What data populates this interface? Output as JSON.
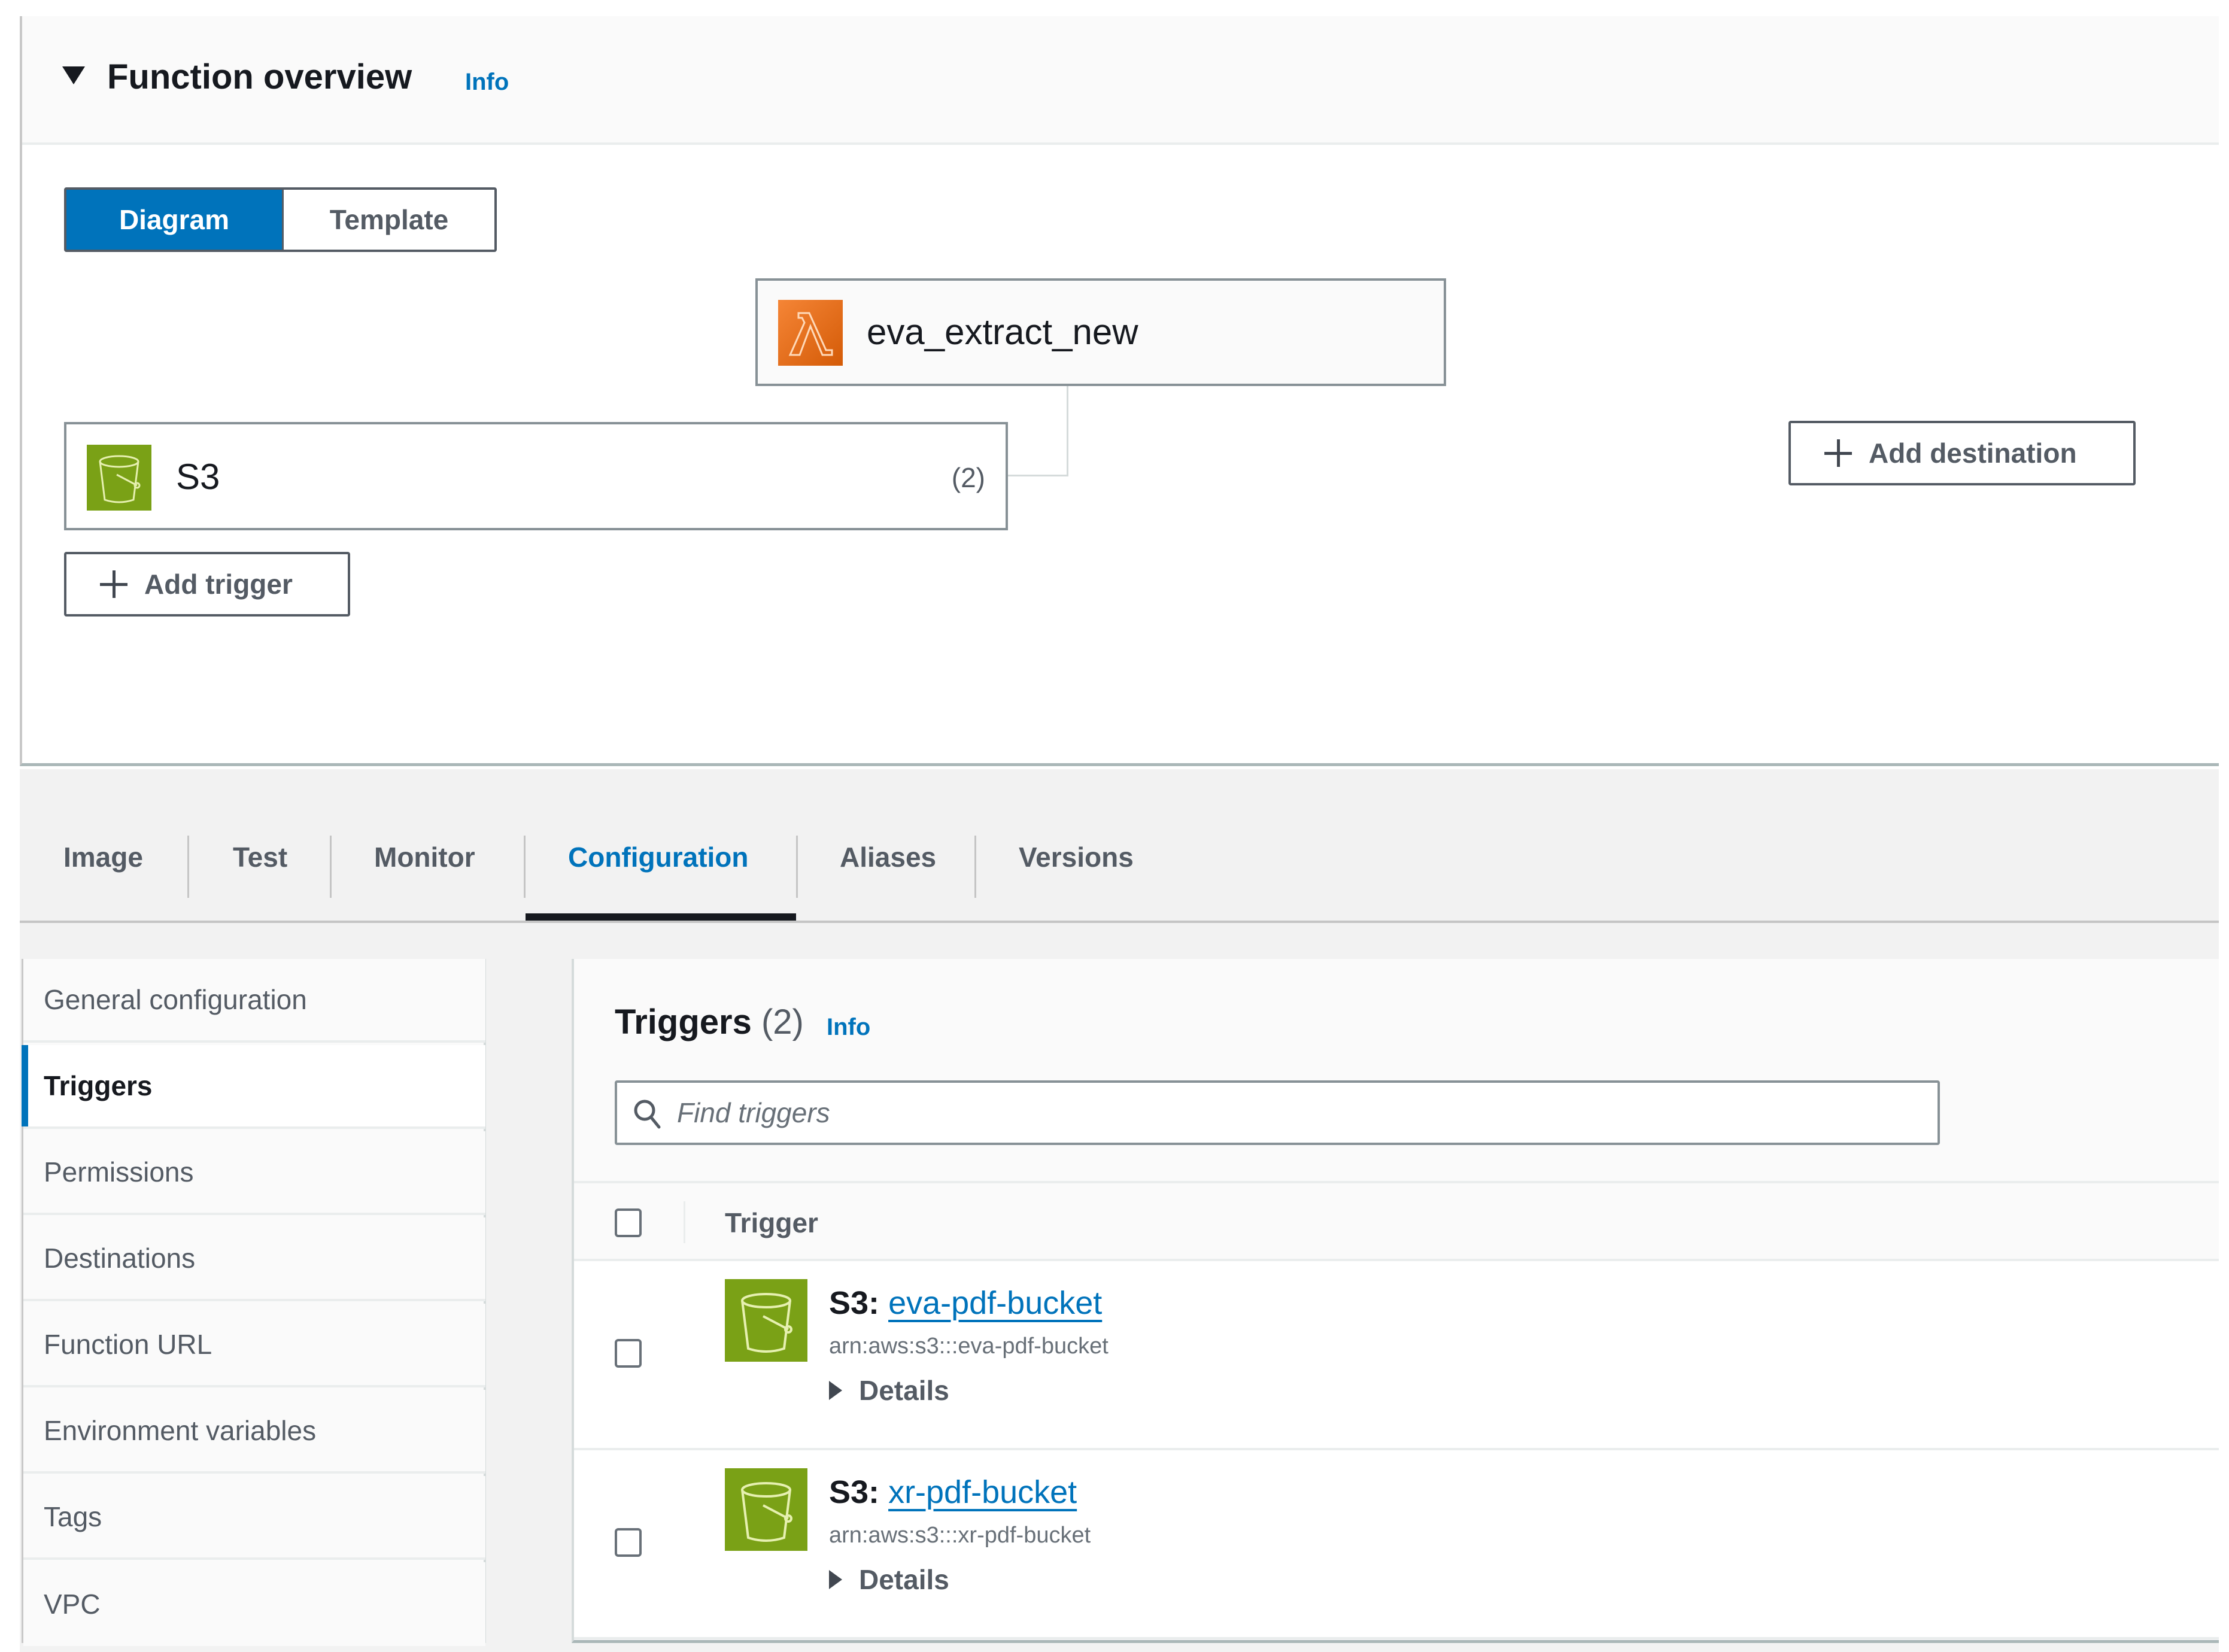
{
  "overview": {
    "title": "Function overview",
    "info_label": "Info",
    "view_toggle": {
      "options": [
        "Diagram",
        "Template"
      ],
      "selected": "Diagram"
    }
  },
  "diagram": {
    "function": {
      "name": "eva_extract_new",
      "icon": "lambda-icon"
    },
    "trigger_node": {
      "label": "S3",
      "count": "(2)",
      "icon": "s3-bucket-icon"
    },
    "add_trigger_label": "Add trigger",
    "add_destination_label": "Add destination"
  },
  "tabs": {
    "items": [
      "Image",
      "Test",
      "Monitor",
      "Configuration",
      "Aliases",
      "Versions"
    ],
    "active": "Configuration"
  },
  "sidebar": {
    "items": [
      "General configuration",
      "Triggers",
      "Permissions",
      "Destinations",
      "Function URL",
      "Environment variables",
      "Tags",
      "VPC"
    ],
    "active": "Triggers"
  },
  "triggers": {
    "title": "Triggers",
    "count": "(2)",
    "info_label": "Info",
    "search": {
      "placeholder": "Find triggers",
      "value": ""
    },
    "column_header": "Trigger",
    "rows": [
      {
        "service": "S3:",
        "bucket": "eva-pdf-bucket",
        "arn": "arn:aws:s3:::eva-pdf-bucket",
        "details_label": "Details",
        "checked": false
      },
      {
        "service": "S3:",
        "bucket": "xr-pdf-bucket",
        "arn": "arn:aws:s3:::xr-pdf-bucket",
        "details_label": "Details",
        "checked": false
      }
    ]
  },
  "colors": {
    "accent_blue": "#0073bb",
    "lambda_orange": "#e9741c",
    "s3_green": "#7aa116",
    "text_dark": "#16191f",
    "text_muted": "#545b64"
  }
}
